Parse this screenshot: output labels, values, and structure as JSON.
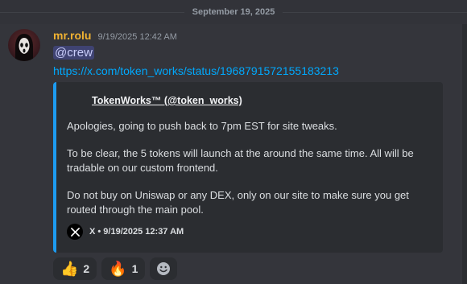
{
  "divider": {
    "date": "September 19, 2025"
  },
  "message": {
    "username": "mr.rolu",
    "timestamp": "9/19/2025 12:42 AM",
    "mention": "@crew",
    "link": "https://x.com/token_works/status/1968791572155183213",
    "embed": {
      "author": "TokenWorks™ (@token_works)",
      "paragraphs": [
        "Apologies, going to push back to 7pm EST for site tweaks.",
        "To be clear, the 5 tokens will launch at the around the same time. All will be tradable on our custom frontend.",
        "Do not buy on Uniswap or any DEX, only on our site to make sure you get routed through the main pool."
      ],
      "footer": "X • 9/19/2025 12:37 AM",
      "accent_color": "#1d9bf0"
    }
  },
  "reactions": [
    {
      "emoji": "👍",
      "count": "2",
      "icon": "thumbs-up-icon"
    },
    {
      "emoji": "🔥",
      "count": "1",
      "icon": "fire-icon"
    }
  ],
  "add_reaction": {
    "emoji": "☻",
    "icon": "add-reaction-icon"
  },
  "colors": {
    "background": "#323339",
    "username": "#f0b232",
    "link": "#00a8fc",
    "embed_bg": "#2b2d31"
  }
}
